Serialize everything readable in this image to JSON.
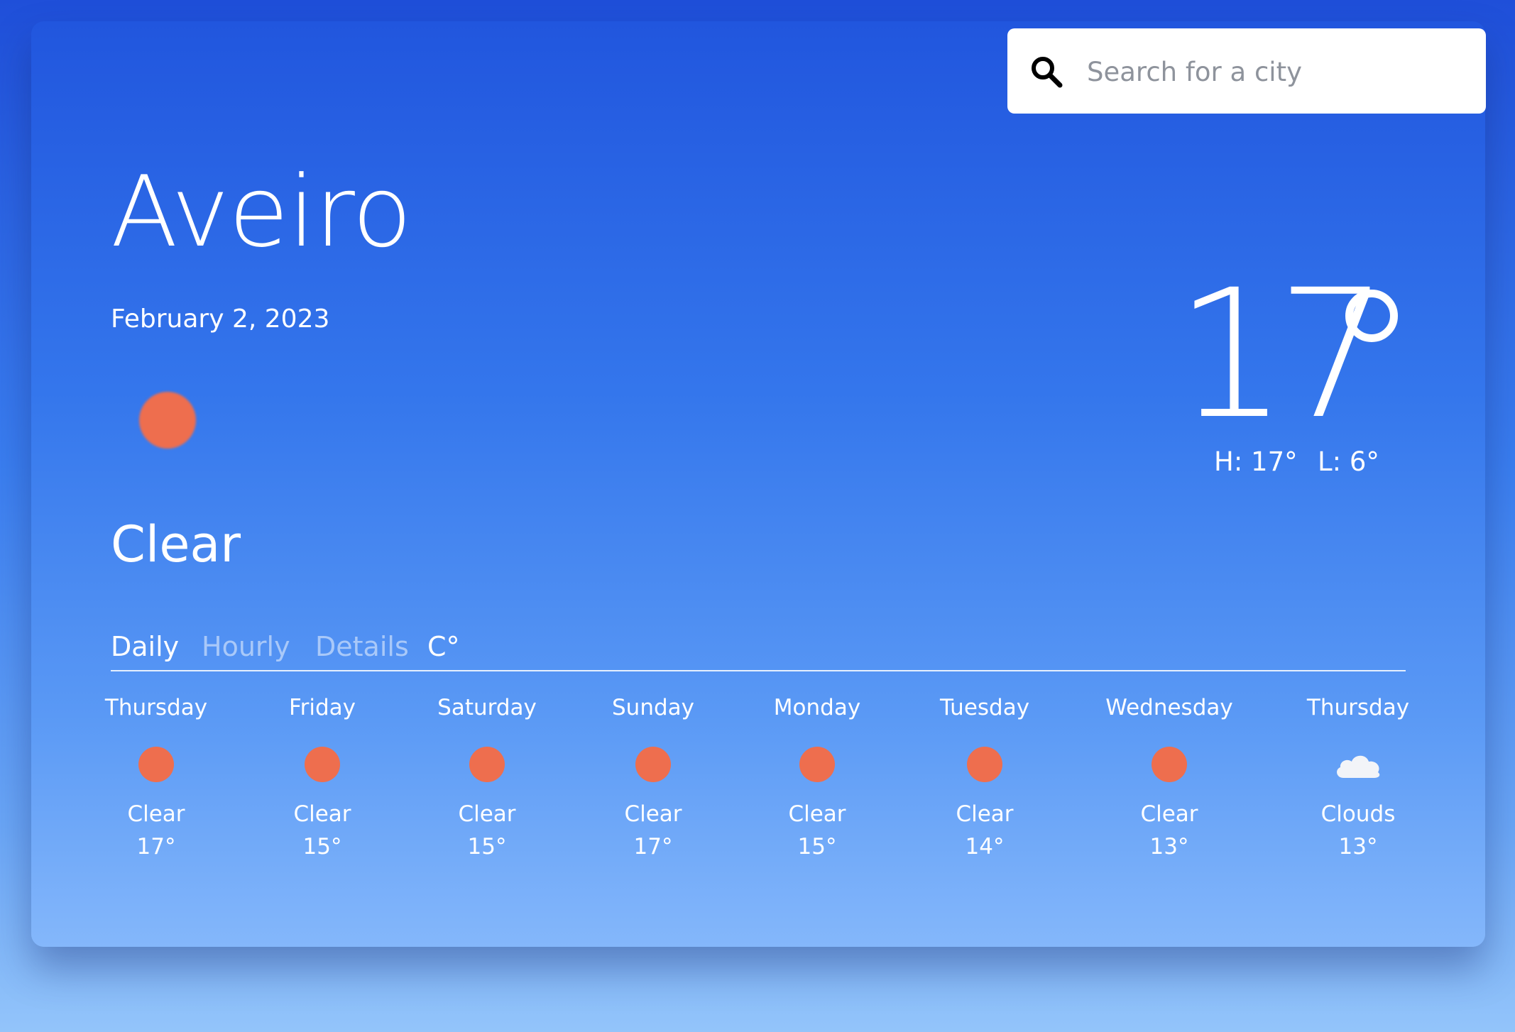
{
  "colors": {
    "accent_sun": "#ee6e4e",
    "background_top": "#1f4fd9",
    "background_bottom": "#93c4fa",
    "search_bg": "#ffffff"
  },
  "search": {
    "placeholder": "Search for a city",
    "icon": "search-icon"
  },
  "current": {
    "city": "Aveiro",
    "date": "February 2, 2023",
    "icon": "sun-icon",
    "condition": "Clear",
    "temperature": "17",
    "high": "H: 17°",
    "low": "L: 6°"
  },
  "tabs": [
    {
      "label": "Daily",
      "active": true
    },
    {
      "label": "Hourly",
      "active": false
    },
    {
      "label": "Details",
      "active": false
    },
    {
      "label": "C°",
      "active": false
    }
  ],
  "forecast": [
    {
      "day": "Thursday",
      "icon": "sun-icon",
      "condition": "Clear",
      "temp": "17°"
    },
    {
      "day": "Friday",
      "icon": "sun-icon",
      "condition": "Clear",
      "temp": "15°"
    },
    {
      "day": "Saturday",
      "icon": "sun-icon",
      "condition": "Clear",
      "temp": "15°"
    },
    {
      "day": "Sunday",
      "icon": "sun-icon",
      "condition": "Clear",
      "temp": "17°"
    },
    {
      "day": "Monday",
      "icon": "sun-icon",
      "condition": "Clear",
      "temp": "15°"
    },
    {
      "day": "Tuesday",
      "icon": "sun-icon",
      "condition": "Clear",
      "temp": "14°"
    },
    {
      "day": "Wednesday",
      "icon": "sun-icon",
      "condition": "Clear",
      "temp": "13°"
    },
    {
      "day": "Thursday",
      "icon": "cloud-icon",
      "condition": "Clouds",
      "temp": "13°"
    }
  ]
}
